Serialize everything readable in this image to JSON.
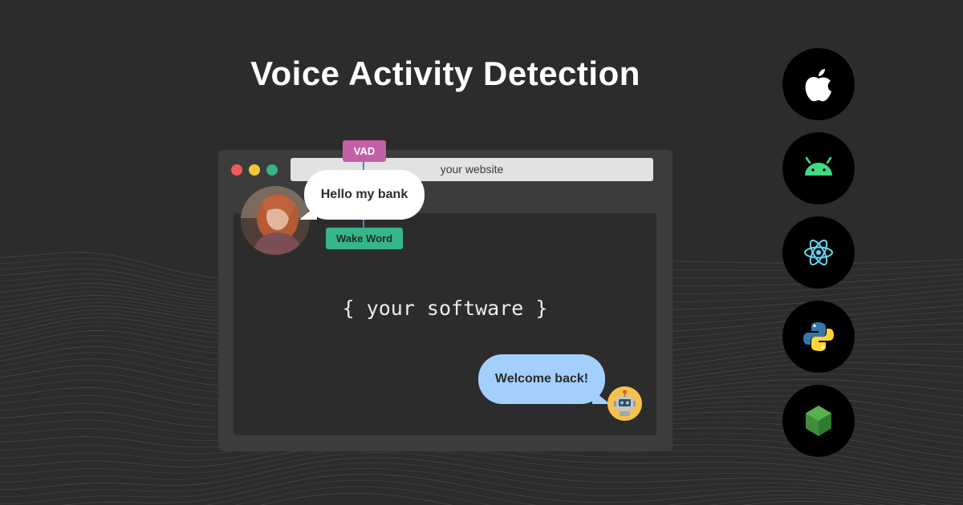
{
  "title": "Voice Activity Detection",
  "browser": {
    "address_bar": "your website",
    "app_label": "{ your software }"
  },
  "tags": {
    "vad": "VAD",
    "wake_word": "Wake Word"
  },
  "conversation": {
    "user_message": "Hello my bank",
    "bot_message": "Welcome back!"
  },
  "platforms": [
    "apple-icon",
    "android-icon",
    "react-icon",
    "python-icon",
    "nodejs-icon"
  ],
  "colors": {
    "background": "#2c2c2c",
    "vad_tag": "#c460a8",
    "wake_word_tag": "#37b58a",
    "bot_bubble": "#a3cffc",
    "user_bubble": "#ffffff",
    "connector": "#4a86d8"
  }
}
